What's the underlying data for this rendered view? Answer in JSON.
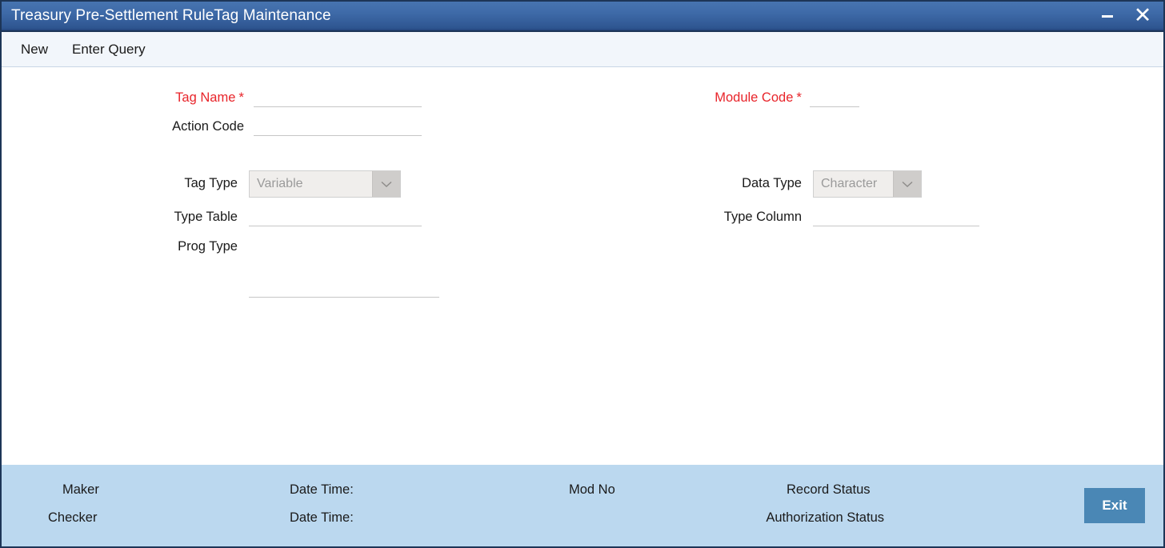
{
  "window": {
    "title": "Treasury Pre-Settlement RuleTag Maintenance",
    "minimize_label": "Minimize",
    "close_label": "Close",
    "accent_color": "#3e6aa8",
    "required_color": "#e8242a",
    "footer_color": "#bbd8ef",
    "exit_button_color": "#4a87b5"
  },
  "toolbar": {
    "items": [
      {
        "label": "New"
      },
      {
        "label": "Enter Query"
      }
    ]
  },
  "form": {
    "left": [
      {
        "label": "Tag Name",
        "required": true,
        "type": "text",
        "value": "",
        "placeholder": ""
      },
      {
        "label": "Action Code",
        "required": false,
        "type": "text",
        "value": "",
        "placeholder": ""
      },
      {
        "label": "Tag Type",
        "required": false,
        "type": "select",
        "value": "Variable",
        "options": [
          "Variable"
        ]
      },
      {
        "label": "Type Table",
        "required": false,
        "type": "text",
        "value": "",
        "placeholder": ""
      },
      {
        "label": "Prog Type",
        "required": false,
        "type": "textarea",
        "value": "",
        "placeholder": ""
      }
    ],
    "right": [
      {
        "label": "Module Code",
        "required": true,
        "type": "text",
        "value": "",
        "placeholder": ""
      },
      {
        "label": "Data Type",
        "required": false,
        "type": "select",
        "value": "Character",
        "options": [
          "Character"
        ]
      },
      {
        "label": "Type Column",
        "required": false,
        "type": "text",
        "value": "",
        "placeholder": ""
      }
    ]
  },
  "footer": {
    "maker_label": "Maker",
    "maker_datetime_label": "Date Time:",
    "checker_label": "Checker",
    "checker_datetime_label": "Date Time:",
    "mod_no_label": "Mod No",
    "record_status_label": "Record Status",
    "authorization_status_label": "Authorization Status",
    "exit_label": "Exit"
  },
  "icons": {
    "minimize": "minimize-icon",
    "close": "close-icon",
    "chevron_down": "chevron-down-icon"
  }
}
